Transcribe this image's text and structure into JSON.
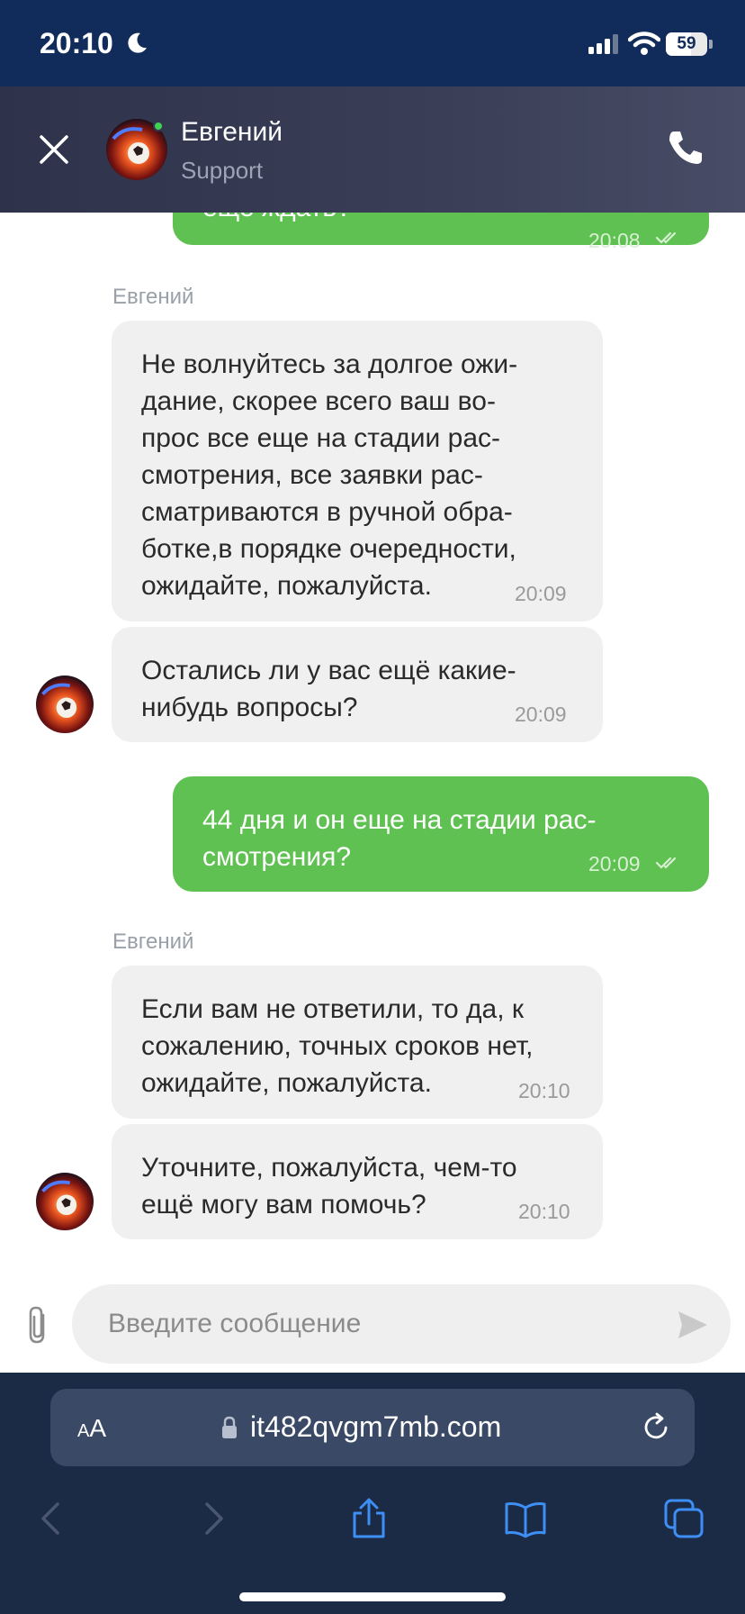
{
  "status_bar": {
    "time": "20:10",
    "battery": "59"
  },
  "header": {
    "agent_name": "Евгений",
    "agent_role": "Support"
  },
  "messages": [
    {
      "type": "out",
      "text": "еще ждать?",
      "time": "20:08"
    },
    {
      "type": "sender",
      "text": "Евгений"
    },
    {
      "type": "in",
      "text": "Не волнуйтесь за долгое ожи-\nдание, скорее всего ваш во-\nпрос все еще на стадии рас-\nсмотрения, все заявки рас-\nсматриваются в ручной обра-\nботке,в порядке очередности,\nожидайте, пожалуйста.",
      "time": "20:09"
    },
    {
      "type": "in",
      "text": "Остались ли у вас ещё какие-\nнибудь вопросы?",
      "time": "20:09"
    },
    {
      "type": "out",
      "text": "44 дня и он еще на стадии рас-\nсмотрения?",
      "time": "20:09"
    },
    {
      "type": "sender",
      "text": "Евгений"
    },
    {
      "type": "in",
      "text": "Если вам не ответили, то да, к\nсожалению, точных сроков нет,\nожидайте, пожалуйста.",
      "time": "20:10"
    },
    {
      "type": "in",
      "text": "Уточните, пожалуйста, чем-то\nещё могу вам помочь?",
      "time": "20:10"
    }
  ],
  "composer": {
    "placeholder": "Введите сообщение"
  },
  "browser": {
    "aa_small": "A",
    "aa_big": "A",
    "url": "it482qvgm7mb.com"
  },
  "colors": {
    "status_bg": "#112c5a",
    "outgoing_bubble": "#5fc151",
    "incoming_bubble": "#f0f0f0",
    "browser_bg": "#1b2b46"
  },
  "icons": [
    "close-icon",
    "phone-icon",
    "attach-icon",
    "send-icon",
    "lock-icon",
    "reload-icon",
    "back-icon",
    "forward-icon",
    "share-icon",
    "bookmarks-icon",
    "tabs-icon"
  ]
}
